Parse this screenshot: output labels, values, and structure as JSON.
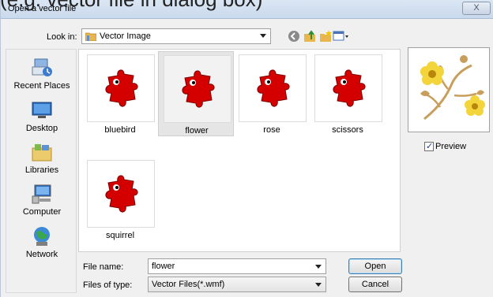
{
  "window": {
    "title": "Open a vector file",
    "close_symbol": "X",
    "overlay_text": "(e.g. vector file in dialog box)"
  },
  "toolbar": {
    "look_in_label": "Look in:",
    "look_in_value": "Vector Image",
    "icons": [
      "back-icon",
      "up-folder-icon",
      "new-folder-icon",
      "view-menu-icon"
    ]
  },
  "places": [
    {
      "label": "Recent Places",
      "icon": "recent-places-icon"
    },
    {
      "label": "Desktop",
      "icon": "desktop-icon"
    },
    {
      "label": "Libraries",
      "icon": "libraries-icon"
    },
    {
      "label": "Computer",
      "icon": "computer-icon"
    },
    {
      "label": "Network",
      "icon": "network-icon"
    }
  ],
  "files": [
    {
      "name": "bluebird",
      "selected": false
    },
    {
      "name": "flower",
      "selected": true
    },
    {
      "name": "rose",
      "selected": false
    },
    {
      "name": "scissors",
      "selected": false
    },
    {
      "name": "squirrel",
      "selected": false
    }
  ],
  "preview": {
    "checkbox_label": "Preview",
    "checked": true
  },
  "form": {
    "file_name_label": "File name:",
    "file_name_value": "flower",
    "file_type_label": "Files of type:",
    "file_type_value": "Vector Files(*.wmf)"
  },
  "buttons": {
    "open": "Open",
    "cancel": "Cancel"
  },
  "colors": {
    "puzzle_icon": "#d40000",
    "flower_petal": "#f3d43a",
    "flower_stem": "#c89e5c"
  }
}
